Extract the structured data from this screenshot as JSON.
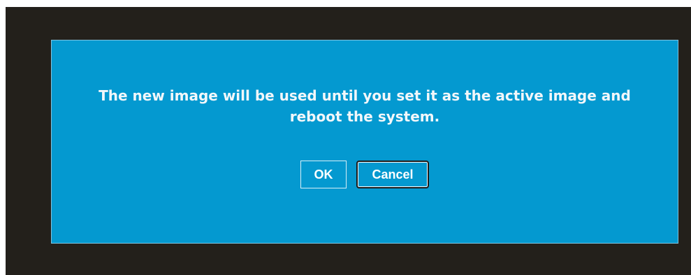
{
  "dialog": {
    "message_line1": "The new image will be used until you set it as the active image and",
    "message_line2": "reboot the system.",
    "ok_label": "OK",
    "cancel_label": "Cancel"
  },
  "colors": {
    "backdrop": "#23201b",
    "dialog_background": "#0499d0",
    "text": "#f2f7fa"
  }
}
